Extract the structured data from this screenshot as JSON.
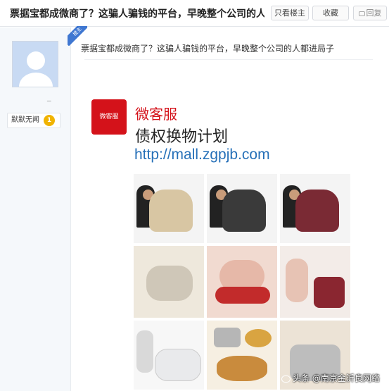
{
  "header": {
    "title": "票据宝都成微商了？这骗人骗钱的平台，早晚整个公司的人都进...",
    "only_author_label": "只看楼主",
    "favorite_label": "收藏",
    "reply_label": "回复"
  },
  "user": {
    "name": "_",
    "level_title": "默默无闻",
    "level_number": "1"
  },
  "post": {
    "floor_badge": "楼主",
    "text": "票据宝都成微商了？这骗人骗钱的平台，早晚整个公司的人都进局子",
    "ad": {
      "logo_text": "微客服",
      "service_name": "微客服",
      "plan_name": "债权换物计划",
      "url": "http://mall.zgpjb.com"
    }
  },
  "watermark": "头条 @南京金沂良网络",
  "colors": {
    "accent": "#d4121a",
    "link": "#2670b8",
    "badge": "#3f77d1"
  }
}
